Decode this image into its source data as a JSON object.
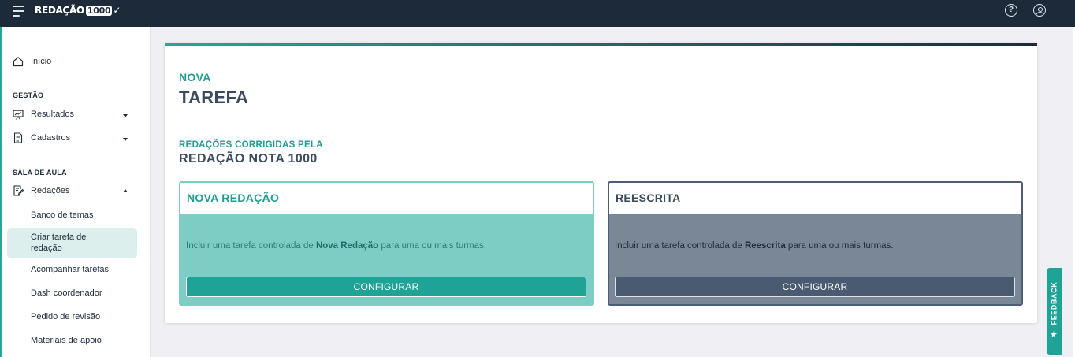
{
  "app": {
    "logo_part1": "REDAÇÃO",
    "logo_part2": "1000",
    "logo_check": "✓",
    "help_glyph": "?"
  },
  "sidebar": {
    "home_label": "Início",
    "section_gestao": "GESTÃO",
    "resultados_label": "Resultados",
    "cadastros_label": "Cadastros",
    "section_sala": "SALA DE AULA",
    "redacoes_label": "Redações",
    "sub_items": [
      "Banco de temas",
      "Criar tarefa de redação",
      "Acompanhar tarefas",
      "Dash coordenador",
      "Pedido de revisão",
      "Materiais de apoio"
    ],
    "active_sub_line1": "Criar tarefa de",
    "active_sub_line2": "redação"
  },
  "page": {
    "eyebrow": "NOVA",
    "title": "TAREFA",
    "subtitle_eyebrow": "REDAÇÕES CORRIGIDAS PELA",
    "subtitle": "REDAÇÃO NOTA 1000"
  },
  "options": {
    "nova": {
      "title": "NOVA REDAÇÃO",
      "desc_before": "Incluir uma tarefa controlada de ",
      "desc_bold": "Nova Redação",
      "desc_after": " para uma ou mais turmas.",
      "button": "CONFIGURAR"
    },
    "reescrita": {
      "title": "REESCRITA",
      "desc_before": "Incluir uma tarefa controlada de ",
      "desc_bold": "Reescrita",
      "desc_after": " para uma ou mais turmas.",
      "button": "CONFIGURAR"
    }
  },
  "feedback": {
    "label": "FEEDBACK",
    "star": "★"
  },
  "icons": {
    "menu": "hamburger-icon",
    "help": "help-circle-icon",
    "user": "user-circle-icon",
    "home": "home-icon",
    "results": "presentation-chart-icon",
    "records": "document-list-icon",
    "essays": "edit-document-icon",
    "feedback_star": "star-icon"
  },
  "colors": {
    "topbar": "#1d2a3a",
    "accent": "#1fa396",
    "accent_light": "#7ecdc4",
    "slate": "#4a5a70",
    "active_bg": "#dcefed"
  }
}
